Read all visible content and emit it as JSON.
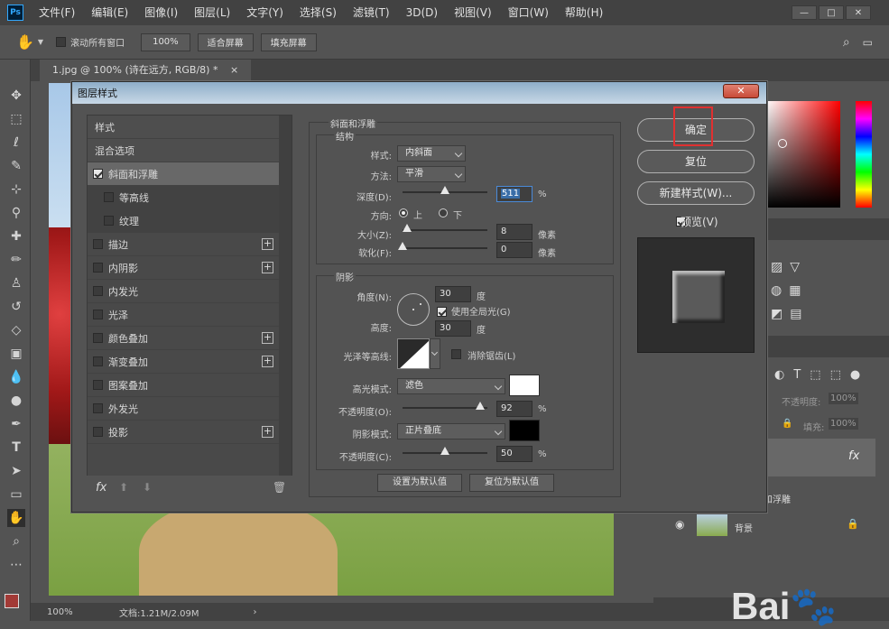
{
  "app": {
    "logo": "Ps",
    "menu": [
      "文件(F)",
      "编辑(E)",
      "图像(I)",
      "图层(L)",
      "文字(Y)",
      "选择(S)",
      "滤镜(T)",
      "3D(D)",
      "视图(V)",
      "窗口(W)",
      "帮助(H)"
    ],
    "window_buttons": [
      "—",
      "□",
      "✕"
    ]
  },
  "options": {
    "scroll_all_label": "滚动所有窗口",
    "zoom_value": "100%",
    "fit_screen": "适合屏幕",
    "fill_screen": "填充屏幕"
  },
  "document": {
    "tab_title": "1.jpg @ 100% (诗在远方, RGB/8) *",
    "tab_close": "×",
    "zoom": "100%",
    "doc_info": "文档:1.21M/2.09M"
  },
  "dialog": {
    "title": "图层样式",
    "close": "✕",
    "style_list": [
      {
        "label": "样式",
        "check": false,
        "plus": false,
        "indent": false,
        "header": true,
        "selected": false
      },
      {
        "label": "混合选项",
        "check": false,
        "plus": false,
        "indent": false,
        "header": true,
        "selected": false
      },
      {
        "label": "斜面和浮雕",
        "check": true,
        "checked": true,
        "plus": false,
        "indent": false,
        "selected": true
      },
      {
        "label": "等高线",
        "check": true,
        "checked": false,
        "plus": false,
        "indent": true,
        "selected": false
      },
      {
        "label": "纹理",
        "check": true,
        "checked": false,
        "plus": false,
        "indent": true,
        "selected": false
      },
      {
        "label": "描边",
        "check": true,
        "checked": false,
        "plus": true,
        "indent": false,
        "selected": false
      },
      {
        "label": "内阴影",
        "check": true,
        "checked": false,
        "plus": true,
        "indent": false,
        "selected": false
      },
      {
        "label": "内发光",
        "check": true,
        "checked": false,
        "plus": false,
        "indent": false,
        "selected": false
      },
      {
        "label": "光泽",
        "check": true,
        "checked": false,
        "plus": false,
        "indent": false,
        "selected": false
      },
      {
        "label": "颜色叠加",
        "check": true,
        "checked": false,
        "plus": true,
        "indent": false,
        "selected": false
      },
      {
        "label": "渐变叠加",
        "check": true,
        "checked": false,
        "plus": true,
        "indent": false,
        "selected": false
      },
      {
        "label": "图案叠加",
        "check": true,
        "checked": false,
        "plus": false,
        "indent": false,
        "selected": false
      },
      {
        "label": "外发光",
        "check": true,
        "checked": false,
        "plus": false,
        "indent": false,
        "selected": false
      },
      {
        "label": "投影",
        "check": true,
        "checked": false,
        "plus": true,
        "indent": false,
        "selected": false
      }
    ],
    "list_footer": {
      "fx": "fx"
    },
    "bevel": {
      "section_title": "斜面和浮雕",
      "structure_title": "结构",
      "style_label": "样式:",
      "style_value": "内斜面",
      "technique_label": "方法:",
      "technique_value": "平滑",
      "depth_label": "深度(D):",
      "depth_value": "511",
      "depth_unit": "%",
      "depth_slider": 0.5,
      "direction_label": "方向:",
      "direction_up": "上",
      "direction_down": "下",
      "size_label": "大小(Z):",
      "size_value": "8",
      "size_unit": "像素",
      "size_slider": 0.05,
      "soften_label": "软化(F):",
      "soften_value": "0",
      "soften_unit": "像素",
      "soften_slider": 0.0
    },
    "shading": {
      "section_title": "阴影",
      "angle_label": "角度(N):",
      "angle_value": "30",
      "angle_unit": "度",
      "global_light_label": "使用全局光(G)",
      "altitude_label": "高度:",
      "altitude_value": "30",
      "altitude_unit": "度",
      "gloss_contour_label": "光泽等高线:",
      "anti_alias_label": "消除锯齿(L)",
      "highlight_mode_label": "高光模式:",
      "highlight_mode_value": "滤色",
      "highlight_color": "#ffffff",
      "highlight_opacity_label": "不透明度(O):",
      "highlight_opacity_value": "92",
      "highlight_opacity_unit": "%",
      "highlight_opacity_slider": 0.92,
      "shadow_mode_label": "阴影模式:",
      "shadow_mode_value": "正片叠底",
      "shadow_color": "#000000",
      "shadow_opacity_label": "不透明度(C):",
      "shadow_opacity_value": "50",
      "shadow_opacity_unit": "%",
      "shadow_opacity_slider": 0.5
    },
    "make_default": "设置为默认值",
    "reset_default": "复位为默认值",
    "ok": "确定",
    "reset": "复位",
    "new_style": "新建样式(W)...",
    "preview_label": "预览(V)"
  },
  "layers": {
    "opacity_label": "不透明度:",
    "opacity_value": "100%",
    "fill_label": "填充:",
    "fill_value": "100%",
    "layer_fx": "fx",
    "effect_name": "和浮雕",
    "bg_layer_name": "背景"
  },
  "colors": {
    "highlight_box": "#e03030"
  }
}
